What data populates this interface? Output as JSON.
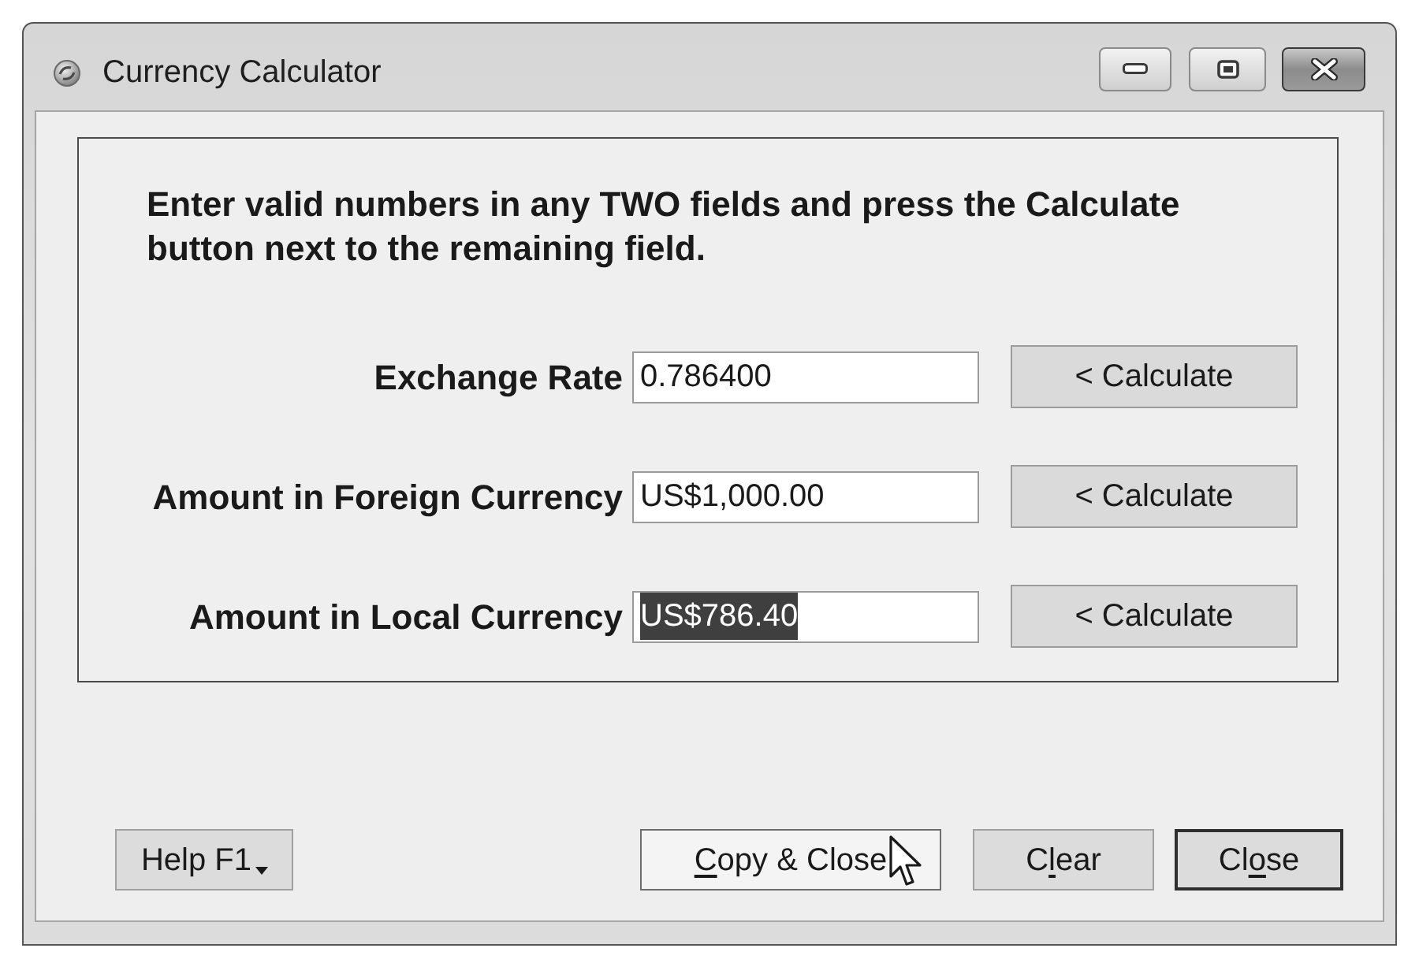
{
  "window": {
    "title": "Currency Calculator"
  },
  "instructions": "Enter valid numbers in any TWO fields and press the Calculate button next to the remaining field.",
  "fields": [
    {
      "label": "Exchange Rate",
      "value": "0.786400",
      "text_selected": false,
      "button": "< Calculate"
    },
    {
      "label": "Amount in Foreign Currency",
      "value": "US$1,000.00",
      "text_selected": false,
      "button": "< Calculate"
    },
    {
      "label": "Amount in Local Currency",
      "value": "US$786.40",
      "text_selected": true,
      "button": "< Calculate"
    }
  ],
  "buttons": [
    {
      "kind": "dropdown",
      "text": "Help F1",
      "default": false,
      "hovered": false
    },
    {
      "kind": "plain",
      "access_key": "C",
      "text_after": "opy & Close",
      "default": false,
      "hovered": true
    },
    {
      "kind": "plain",
      "text": "C",
      "access_key": "l",
      "text_after": "ear",
      "default": false,
      "hovered": false
    },
    {
      "kind": "plain",
      "text": "Cl",
      "access_key": "o",
      "text_after": "se",
      "default": true,
      "hovered": false
    }
  ]
}
